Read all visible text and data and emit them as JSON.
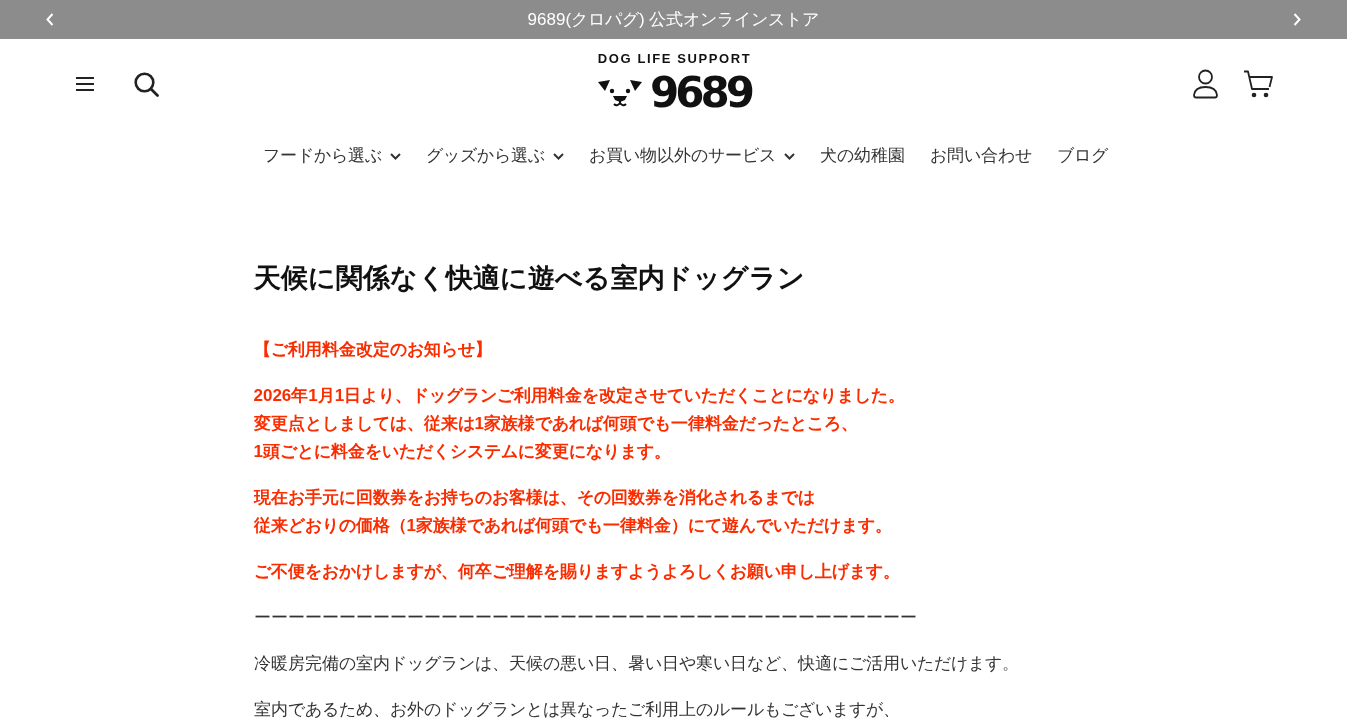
{
  "announcement_bar": {
    "text": "9689(クロパグ) 公式オンラインストア"
  },
  "header": {
    "logo": {
      "tagline": "DOG LIFE SUPPORT",
      "wordmark": "9689"
    }
  },
  "nav": [
    {
      "label": "フードから選ぶ",
      "dropdown": true
    },
    {
      "label": "グッズから選ぶ",
      "dropdown": true
    },
    {
      "label": "お買い物以外のサービス",
      "dropdown": true
    },
    {
      "label": "犬の幼稚園",
      "dropdown": false
    },
    {
      "label": "お問い合わせ",
      "dropdown": false
    },
    {
      "label": "ブログ",
      "dropdown": false
    }
  ],
  "page": {
    "title": "天候に関係なく快適に遊べる室内ドッグラン",
    "blocks": [
      {
        "kind": "notice",
        "lines": [
          "【ご利用料金改定のお知らせ】"
        ]
      },
      {
        "kind": "notice",
        "lines": [
          "2026年1月1日より、ドッグランご利用料金を改定させていただくことになりました。",
          "変更点としましては、従来は1家族様であれば何頭でも一律料金だったところ、",
          "1頭ごとに料金をいただくシステムに変更になります。"
        ]
      },
      {
        "kind": "notice",
        "lines": [
          "現在お手元に回数券をお持ちのお客様は、その回数券を消化されるまでは",
          "従来どおりの価格（1家族様であれば何頭でも一律料金）にて遊んでいただけます。"
        ]
      },
      {
        "kind": "notice",
        "lines": [
          "ご不便をおかけしますが、何卒ご理解を賜りますようよろしくお願い申し上げます。"
        ]
      },
      {
        "kind": "divider",
        "lines": [
          "ーーーーーーーーーーーーーーーーーーーーーーーーーーーーーーーーーーーーーーー"
        ]
      },
      {
        "kind": "body",
        "lines": [
          "冷暖房完備の室内ドッグランは、天候の悪い日、暑い日や寒い日など、快適にご活用いただけます。"
        ]
      },
      {
        "kind": "body",
        "lines": [
          "室内であるため、お外のドッグランとは異なったご利用上のルールもございますが、"
        ]
      }
    ]
  }
}
